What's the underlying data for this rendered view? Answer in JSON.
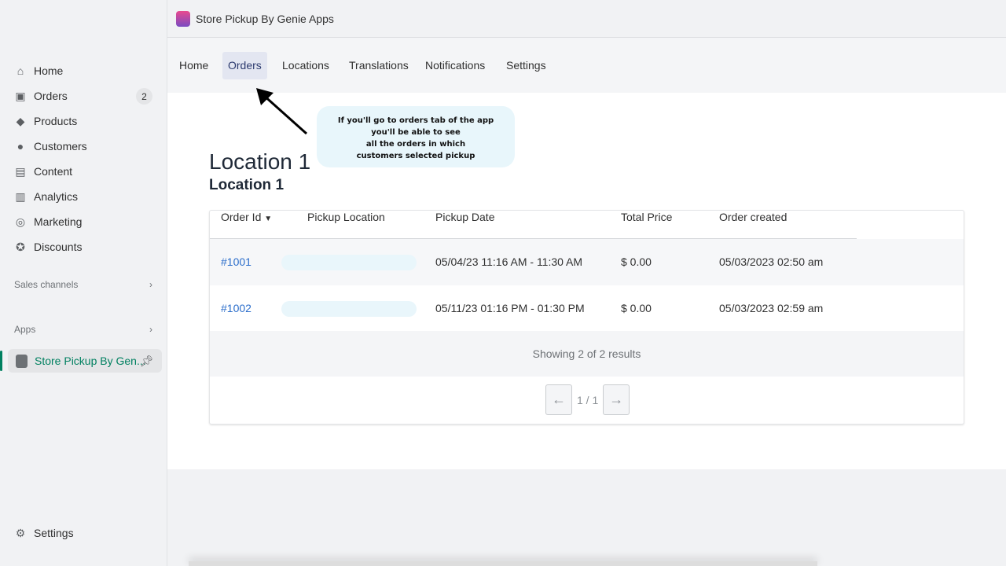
{
  "sidebar": {
    "items": [
      {
        "label": "Home",
        "icon": "home-icon"
      },
      {
        "label": "Orders",
        "icon": "orders-icon",
        "badge": "2"
      },
      {
        "label": "Products",
        "icon": "tag-icon"
      },
      {
        "label": "Customers",
        "icon": "person-icon"
      },
      {
        "label": "Content",
        "icon": "content-icon"
      },
      {
        "label": "Analytics",
        "icon": "bar-chart-icon"
      },
      {
        "label": "Marketing",
        "icon": "target-icon"
      },
      {
        "label": "Discounts",
        "icon": "discount-icon"
      }
    ],
    "sales_channels": "Sales channels",
    "apps": "Apps",
    "app_item": "Store Pickup By Gen...",
    "settings": "Settings"
  },
  "header": {
    "title": "Store Pickup By Genie Apps"
  },
  "tabs": [
    "Home",
    "Orders",
    "Locations",
    "Translations",
    "Notifications",
    "Settings"
  ],
  "active_tab": "Orders",
  "callout": [
    "If you'll go to orders tab of the app",
    "you'll be able to see",
    "all the orders in which",
    "customers selected pickup"
  ],
  "main": {
    "title": "Location 1",
    "subtitle": "Location 1"
  },
  "table": {
    "columns": [
      "Order Id",
      "Pickup Location",
      "Pickup Date",
      "Total Price",
      "Order created"
    ],
    "rows": [
      {
        "id": "#1001",
        "date": "05/04/23 11:16 AM - 11:30 AM",
        "price": "$ 0.00",
        "created": "05/03/2023 02:50 am"
      },
      {
        "id": "#1002",
        "date": "05/11/23 01:16 PM - 01:30 PM",
        "price": "$ 0.00",
        "created": "05/03/2023 02:59 am"
      }
    ],
    "summary": "Showing 2 of 2 results",
    "page": "1 / 1"
  },
  "colors": {
    "accent": "#008060",
    "link": "#2c6ecb",
    "callout_bg": "#e8f6fb"
  }
}
